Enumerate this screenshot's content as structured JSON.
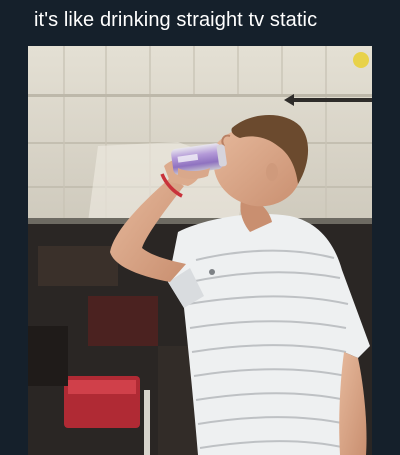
{
  "meme": {
    "caption": "it's like drinking straight tv static"
  },
  "photo": {
    "subject_icon": "person-drinking-can-icon",
    "colors": {
      "background": "#15202b",
      "caption_text": "#ffffff",
      "garage_door": "#dcd8cc",
      "garage_shadow": "#2a2624",
      "shirt": "#eef0f1",
      "can": "#a98cd0",
      "skin": "#d9a88b",
      "hair": "#6b4a2e"
    }
  }
}
